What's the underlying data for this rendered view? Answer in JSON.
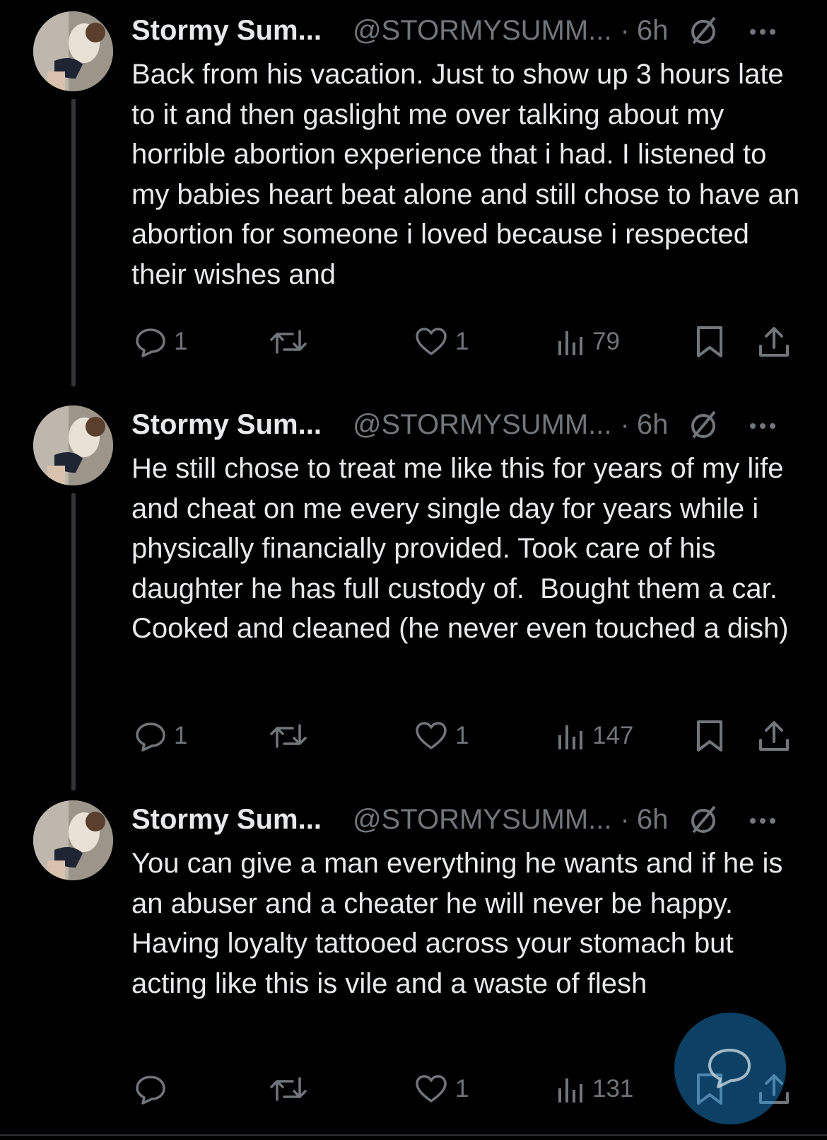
{
  "tweets": [
    {
      "name": "Stormy Sum...",
      "handle": "@STORMYSUMM...",
      "sep": "·",
      "time": "6h",
      "text": "Back from his vacation. Just to show up 3 hours late to it and then gaslight me over talking about my horrible abortion experience that i had. I listened to my babies heart beat alone and still chose to have an abortion for someone i loved because i respected their wishes and",
      "replies": "1",
      "retweets": "",
      "likes": "1",
      "views": "79"
    },
    {
      "name": "Stormy Sum...",
      "handle": "@STORMYSUMM...",
      "sep": "·",
      "time": "6h",
      "text": "He still chose to treat me like this for years of my life and cheat on me every single day for years while i physically financially provided. Took care of his daughter he has full custody of.  Bought them a car. Cooked and cleaned (he never even touched a dish)",
      "replies": "1",
      "retweets": "",
      "likes": "1",
      "views": "147"
    },
    {
      "name": "Stormy Sum...",
      "handle": "@STORMYSUMM...",
      "sep": "·",
      "time": "6h",
      "text": "You can give a man everything he wants and if he is an abuser and a cheater he will never be happy. Having loyalty tattooed across your stomach but acting like this is vile and a waste of flesh",
      "replies": "",
      "retweets": "",
      "likes": "1",
      "views": "131"
    }
  ],
  "icons": [
    "reply-icon",
    "retweet-icon",
    "like-icon",
    "views-icon",
    "bookmark-icon",
    "share-icon",
    "no-reply-icon",
    "more-icon",
    "compose-icon"
  ],
  "colors": {
    "background": "#000000",
    "text": "#e7e9ea",
    "muted": "#71767b",
    "accent": "#1d9bf0"
  }
}
